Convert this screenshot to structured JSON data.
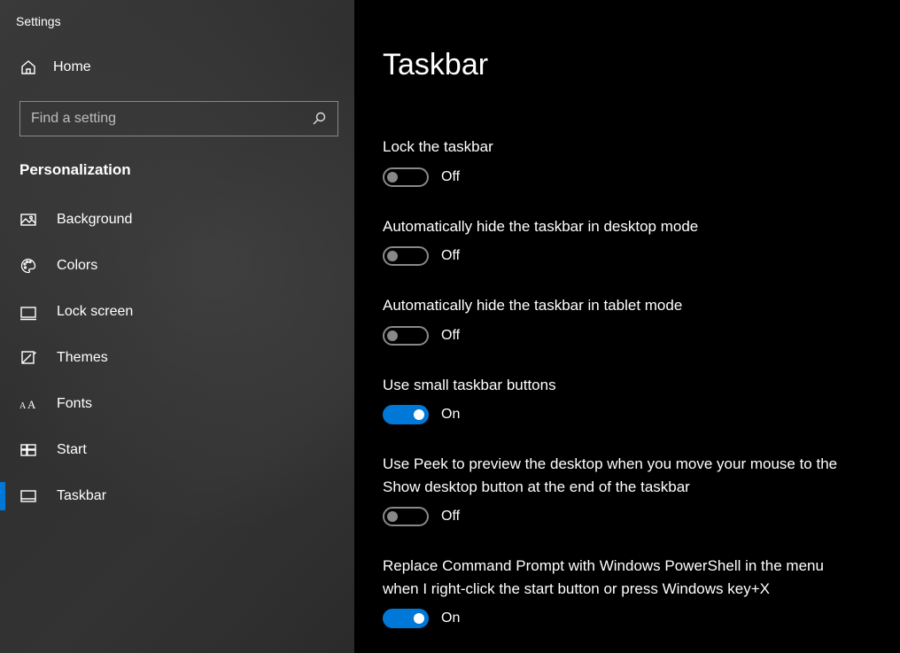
{
  "app_title": "Settings",
  "home_label": "Home",
  "search_placeholder": "Find a setting",
  "section_header": "Personalization",
  "nav": [
    {
      "key": "background",
      "label": "Background",
      "icon": "picture-icon",
      "active": false
    },
    {
      "key": "colors",
      "label": "Colors",
      "icon": "palette-icon",
      "active": false
    },
    {
      "key": "lockscreen",
      "label": "Lock screen",
      "icon": "lockscreen-icon",
      "active": false
    },
    {
      "key": "themes",
      "label": "Themes",
      "icon": "themes-icon",
      "active": false
    },
    {
      "key": "fonts",
      "label": "Fonts",
      "icon": "fonts-icon",
      "active": false
    },
    {
      "key": "start",
      "label": "Start",
      "icon": "start-icon",
      "active": false
    },
    {
      "key": "taskbar",
      "label": "Taskbar",
      "icon": "taskbar-icon",
      "active": true
    }
  ],
  "page_title": "Taskbar",
  "toggle_state_on": "On",
  "toggle_state_off": "Off",
  "settings": [
    {
      "key": "lock",
      "label": "Lock the taskbar",
      "value": false
    },
    {
      "key": "hide_desktop",
      "label": "Automatically hide the taskbar in desktop mode",
      "value": false
    },
    {
      "key": "hide_tablet",
      "label": "Automatically hide the taskbar in tablet mode",
      "value": false
    },
    {
      "key": "small_buttons",
      "label": "Use small taskbar buttons",
      "value": true
    },
    {
      "key": "peek",
      "label": "Use Peek to preview the desktop when you move your mouse to the Show desktop button at the end of the taskbar",
      "value": false
    },
    {
      "key": "powershell",
      "label": "Replace Command Prompt with Windows PowerShell in the menu when I right-click the start button or press Windows key+X",
      "value": true
    }
  ]
}
